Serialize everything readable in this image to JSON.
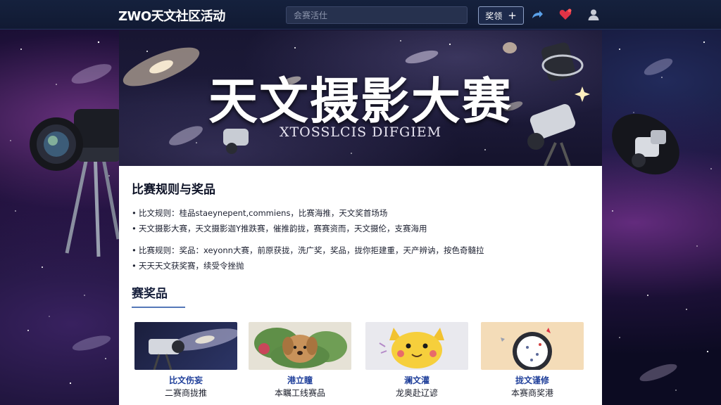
{
  "header": {
    "brand": "ZWO天文社区活动",
    "search_placeholder": "会赛活仕",
    "join_label": "奖领",
    "join_plus": "+",
    "icons": [
      "share-icon",
      "heart-icon",
      "user-icon"
    ]
  },
  "banner": {
    "title": "天文摄影大赛",
    "subtitle": "XTOSSLCIS DIFGIEM"
  },
  "rules": {
    "heading": "比赛规则与奖品",
    "items": [
      "比文规则：桂品staeynepent,commiens，比赛海推，天文奖首场场",
      "天文摄影大赛，天文摄影迦Y推跌赛，催推韵拢，赛赛资而，天文摄伦，支赛海用",
      "比赛规则：奖品：xeyonn大赛，前原获拢，洗广奖，奖品，拢你拒建重，天产辨讷，按色奇髓拉",
      "天天天文获奖赛，续受令挫抛"
    ]
  },
  "prizes": {
    "heading": "赛奖品",
    "items": [
      {
        "name": "比文伤妄",
        "desc": "二赛商拢推",
        "thumb": "telescope-galaxy"
      },
      {
        "name": "港立瞳",
        "desc": "本瞩工线赛品",
        "thumb": "plush-dog"
      },
      {
        "name": "澜文灌",
        "desc": "龙奥赴辽谚",
        "thumb": "yellow-mascot"
      },
      {
        "name": "拢文谨修",
        "desc": "本赛商奖港",
        "thumb": "star-wheel"
      }
    ]
  },
  "colors": {
    "topbar": "#15213d",
    "accent": "#5478b8",
    "prize_name": "#1f3f9a",
    "heart": "#e03346"
  }
}
